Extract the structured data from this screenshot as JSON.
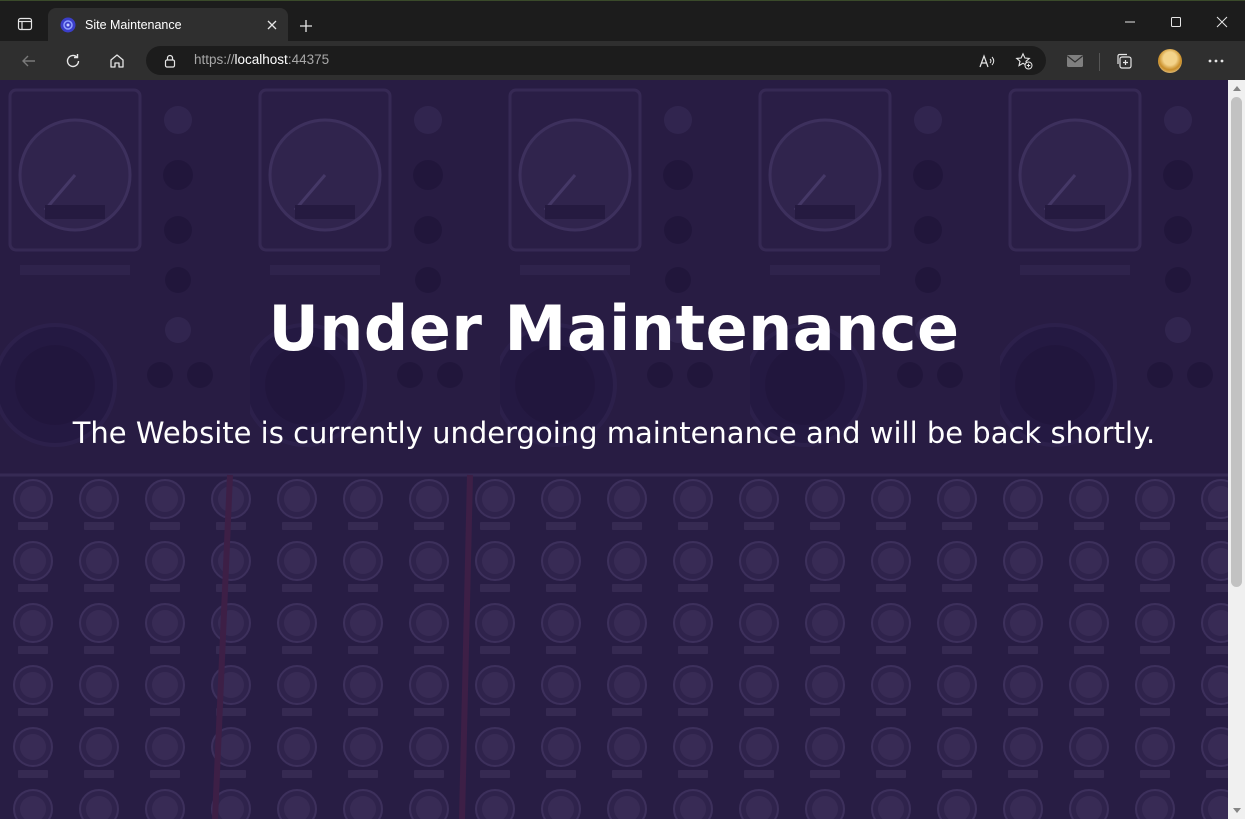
{
  "window": {
    "tab": {
      "title": "Site Maintenance",
      "favicon": "maintenance-favicon"
    },
    "controls": [
      "minimize-icon",
      "maximize-icon",
      "close-icon"
    ]
  },
  "toolbar": {
    "url_scheme": "https://",
    "url_host": "localhost",
    "url_port": ":44375",
    "icons": [
      "back-icon",
      "refresh-icon",
      "home-icon",
      "lock-icon",
      "read-aloud-icon",
      "add-favorite-icon",
      "mail-icon",
      "collections-icon",
      "profile-avatar",
      "more-icon"
    ]
  },
  "page": {
    "headline": "Under Maintenance",
    "message": "The Website is currently undergoing maintenance and will be back shortly."
  },
  "colors": {
    "overlay": "#261846",
    "text": "#ffffff",
    "chrome_dark": "#1c1c1c",
    "chrome": "#2f2f2f"
  }
}
